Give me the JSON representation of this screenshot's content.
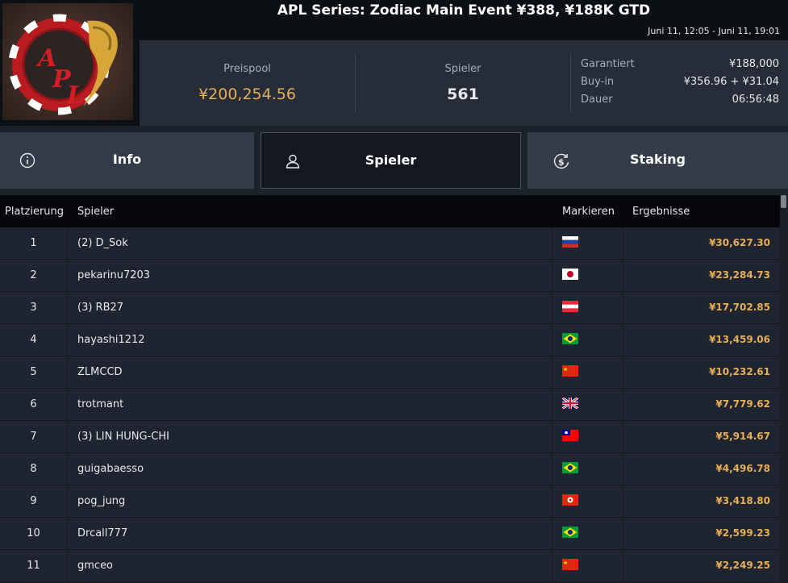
{
  "header": {
    "title": "APL Series: Zodiac Main Event ¥388, ¥188K GTD",
    "dates": "Juni 11, 12:05 - Juni 11, 19:01"
  },
  "stats": {
    "prizepool_label": "Preispool",
    "prizepool_value": "¥200,254.56",
    "players_label": "Spieler",
    "players_value": "561",
    "guaranteed_label": "Garantiert",
    "guaranteed_value": "¥188,000",
    "buyin_label": "Buy-in",
    "buyin_value": "¥356.96 + ¥31.04",
    "duration_label": "Dauer",
    "duration_value": "06:56:48"
  },
  "tabs": [
    {
      "label": "Info",
      "icon": "info-icon",
      "active": false
    },
    {
      "label": "Spieler",
      "icon": "user-icon",
      "active": true
    },
    {
      "label": "Staking",
      "icon": "dollar-refresh-icon",
      "active": false
    }
  ],
  "table": {
    "headers": [
      "Platzierung",
      "Spieler",
      "Markieren",
      "Ergebnisse"
    ],
    "rows": [
      {
        "rank": "1",
        "name": "(2) D_Sok",
        "flag": "russia",
        "result": "¥30,627.30"
      },
      {
        "rank": "2",
        "name": "pekarinu7203",
        "flag": "japan",
        "result": "¥23,284.73"
      },
      {
        "rank": "3",
        "name": "(3) RB27",
        "flag": "austria",
        "result": "¥17,702.85"
      },
      {
        "rank": "4",
        "name": "hayashi1212",
        "flag": "brazil",
        "result": "¥13,459.06"
      },
      {
        "rank": "5",
        "name": "ZLMCCD",
        "flag": "china",
        "result": "¥10,232.61"
      },
      {
        "rank": "6",
        "name": "trotmant",
        "flag": "uk",
        "result": "¥7,779.62"
      },
      {
        "rank": "7",
        "name": "(3) LIN HUNG-CHI",
        "flag": "taiwan",
        "result": "¥5,914.67"
      },
      {
        "rank": "8",
        "name": "guigabaesso",
        "flag": "brazil",
        "result": "¥4,496.78"
      },
      {
        "rank": "9",
        "name": "pog_jung",
        "flag": "hongkong",
        "result": "¥3,418.80"
      },
      {
        "rank": "10",
        "name": "Drcall777",
        "flag": "brazil",
        "result": "¥2,599.23"
      },
      {
        "rank": "11",
        "name": "gmceo",
        "flag": "china",
        "result": "¥2,249.25"
      }
    ]
  },
  "colors": {
    "accent_gold": "#e6ae58",
    "background": "#1c222c"
  }
}
